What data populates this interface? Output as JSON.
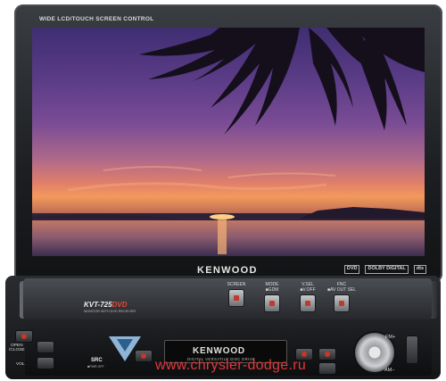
{
  "monitor": {
    "top_label": "WIDE LCD/TOUCH SCREEN CONTROL",
    "brand": "KENWOOD",
    "logos": [
      "DVD",
      "DOLBY DIGITAL",
      "dts"
    ]
  },
  "faceplate": {
    "model": "KVT-725",
    "model_suffix": "DVD",
    "model_subtitle": "MONITOR WITH DVD RECEIVER",
    "controls": [
      {
        "top": "",
        "bottom": "SCREEN"
      },
      {
        "top": "MODE",
        "bottom": "■GDM"
      },
      {
        "top": "V.SEL",
        "bottom": "■V.OFF"
      },
      {
        "top": "FNC",
        "bottom": "■AV OUT SEL"
      }
    ]
  },
  "lower": {
    "open_close": "OPEN\n/CLOSE",
    "vol": "VOL",
    "src": "SRC",
    "src_sub": "■PWR OFF",
    "slot_brand": "KENWOOD",
    "slot_sub": "DIGITAL VERSATILE DISC DRIVE",
    "fm": "FM+",
    "am": "AM−"
  },
  "watermark": "www.chrysler-dodge.ru"
}
